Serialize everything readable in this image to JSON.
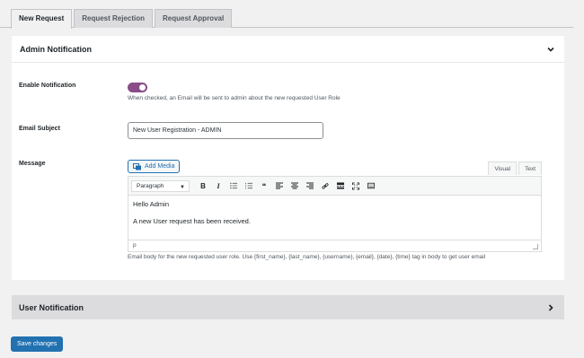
{
  "tabs": [
    {
      "label": "New Request",
      "active": true
    },
    {
      "label": "Request Rejection",
      "active": false
    },
    {
      "label": "Request Approval",
      "active": false
    }
  ],
  "admin": {
    "title": "Admin Notification",
    "enable_label": "Enable Notification",
    "toggle_checked": true,
    "toggle_color": "#8a4d88",
    "enable_desc": "When checked, an Email will be sent to admin about the new requested User Role",
    "subject_label": "Email Subject",
    "subject_value": "New User Registration - ADMIN",
    "message_label": "Message",
    "add_media": "Add Media",
    "editor_tabs": [
      "Visual",
      "Text"
    ],
    "format_select": "Paragraph",
    "content": [
      "Hello Admin",
      "A new User request has been received."
    ],
    "status_path": "p",
    "email_desc": "Email body for the new requested user role. Use {first_name}, {last_name}, {username}, {email}, {date}, {time} tag in body to get user email"
  },
  "user": {
    "title": "User Notification"
  },
  "save_label": "Save changes",
  "colors": {
    "accent": "#2271b1",
    "toggle": "#8a4d88"
  }
}
